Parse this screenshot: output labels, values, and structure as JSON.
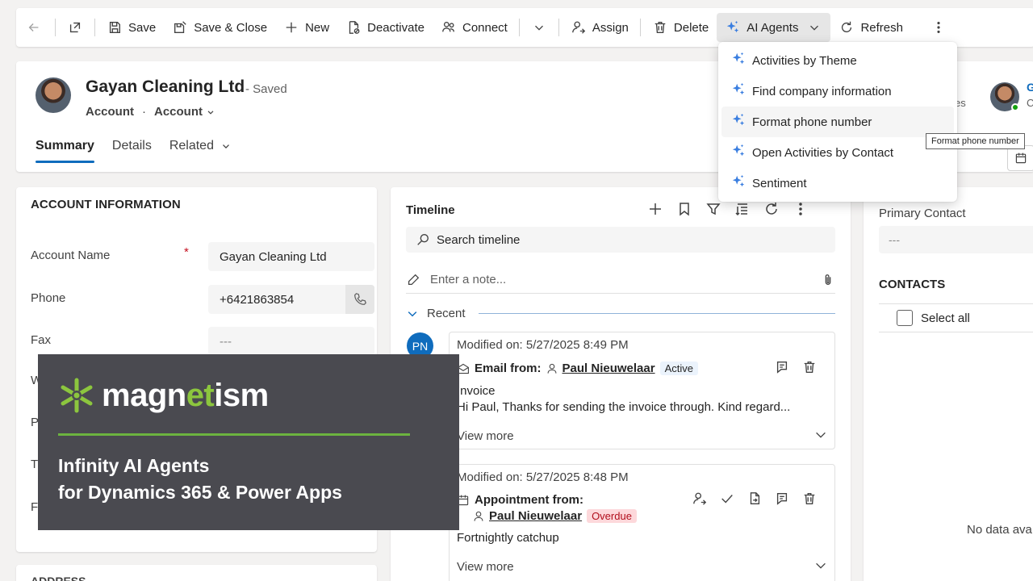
{
  "toolbar": {
    "save": "Save",
    "save_close": "Save & Close",
    "new": "New",
    "deactivate": "Deactivate",
    "connect": "Connect",
    "assign": "Assign",
    "delete": "Delete",
    "ai_agents": "AI Agents",
    "refresh": "Refresh"
  },
  "record": {
    "title": "Gayan Cleaning Ltd",
    "status": "- Saved",
    "entity": "Account",
    "form": "Account",
    "header_right_text": "es",
    "header_right_g": "G",
    "header_right_c": "C"
  },
  "tabs": [
    "Summary",
    "Details",
    "Related"
  ],
  "account_info": {
    "title": "ACCOUNT INFORMATION",
    "fields": [
      {
        "label": "Account Name",
        "value": "Gayan Cleaning Ltd",
        "required": "*"
      },
      {
        "label": "Phone",
        "value": "+6421863854"
      },
      {
        "label": "Fax",
        "value": "---"
      }
    ],
    "partial_labels": [
      "W",
      "P",
      "T",
      "F"
    ],
    "address_title": "ADDRESS"
  },
  "timeline": {
    "title": "Timeline",
    "search_placeholder": "Search timeline",
    "note_placeholder": "Enter a note...",
    "recent": "Recent",
    "avatar_initials": "PN",
    "entries": [
      {
        "modified": "Modified on: 5/27/2025 8:49 PM",
        "type": "Email from:",
        "person": "Paul Nieuwelaar",
        "badge": "Active",
        "subject": "Invoice",
        "body": "Hi Paul,   Thanks for sending the invoice through.   Kind regard...",
        "more": "View more"
      },
      {
        "modified": "Modified on: 5/27/2025 8:48 PM",
        "type": "Appointment from:",
        "person": "Paul Nieuwelaar",
        "badge": "Overdue",
        "subject": "Fortnightly catchup",
        "more": "View more"
      }
    ]
  },
  "right_panel": {
    "primary_contact_label": "Primary Contact",
    "primary_contact_value": "---",
    "contacts_title": "CONTACTS",
    "select_all": "Select all",
    "no_data": "No data ava"
  },
  "ai_menu": {
    "items": [
      "Activities by Theme",
      "Find company information",
      "Format phone number",
      "Open Activities by Contact",
      "Sentiment"
    ],
    "tooltip": "Format phone number"
  },
  "promo": {
    "logo_a": "magn",
    "logo_b": "et",
    "logo_c": "ism",
    "line1": "Infinity AI Agents",
    "line2": "for Dynamics 365 & Power Apps"
  },
  "colors": {
    "accent": "#0f6cbd",
    "promo_bg": "#4a4a50",
    "brand_green": "#8cc63e"
  }
}
